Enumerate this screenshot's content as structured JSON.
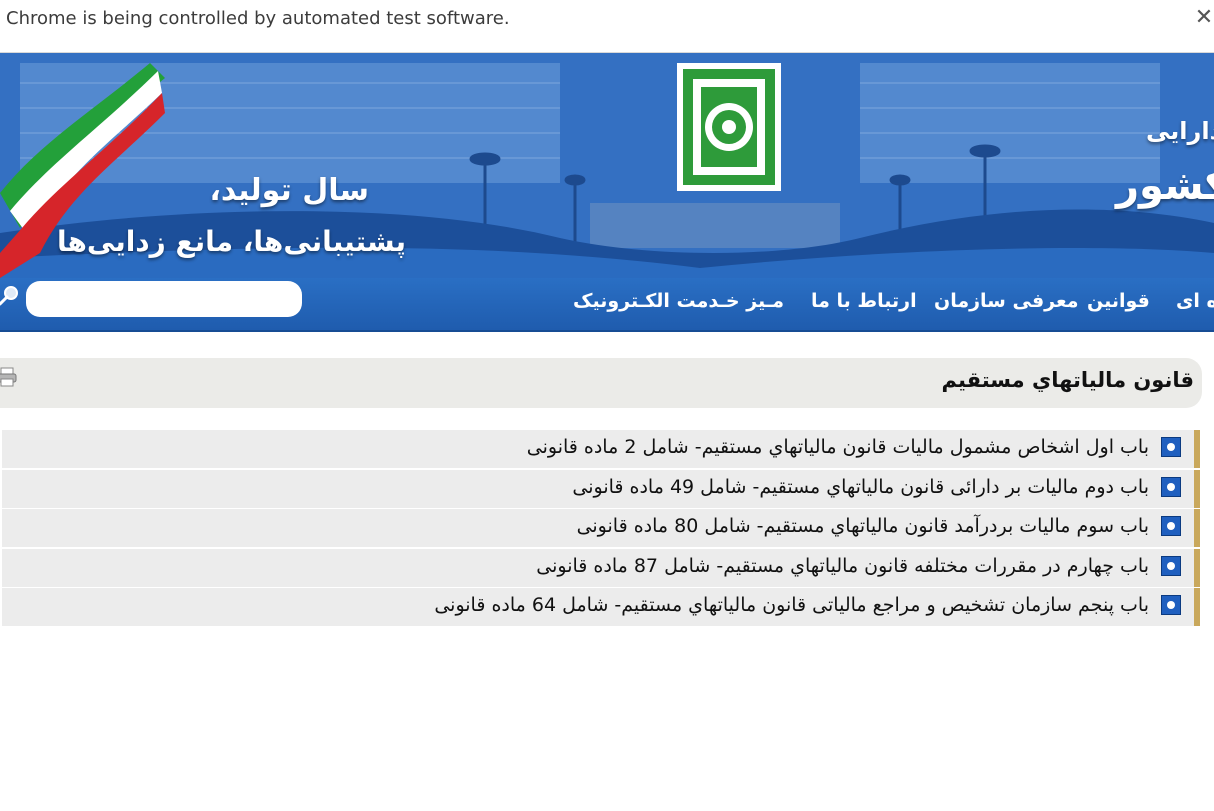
{
  "infobar": {
    "message": "Chrome is being controlled by automated test software.",
    "close_label": "✕"
  },
  "banner": {
    "slogan_line1": "سال تولید،",
    "slogan_line2": "پشتیبانی‌ها، مانع زدایی‌ها",
    "org_line1": "ی و دارایی",
    "org_line2": "یاتی کشور",
    "colors": {
      "sky": "#2f63b7",
      "emblem_green": "#2e9b3a"
    }
  },
  "nav": {
    "items": [
      {
        "label": "ه ای"
      },
      {
        "label": "قوانین"
      },
      {
        "label": "معرفی سازمان"
      },
      {
        "label": "ارتباط با ما"
      },
      {
        "label": "مـیز خـدمت الکـترونیک"
      }
    ],
    "search": {
      "value": "",
      "placeholder": ""
    }
  },
  "content": {
    "title": "قانون مالياتهاي مستقيم",
    "items": [
      {
        "label": "باب اول اشخاص مشمول ماليات قانون مالياتهاي مستقيم- شامل 2 ماده قانونی"
      },
      {
        "label": "باب دوم ماليات بر دارائی قانون مالياتهاي مستقيم- شامل 49 ماده قانونی"
      },
      {
        "label": "باب سوم ماليات بردرآمد قانون مالياتهاي مستقيم- شامل 80 ماده قانونی"
      },
      {
        "label": "باب چهارم در مقررات مختلفه قانون مالياتهاي مستقيم- شامل 87 ماده قانونی"
      },
      {
        "label": "باب پنجم سازمان تشخيص و مراجع مالیاتی قانون مالياتهاي مستقيم- شامل 64 ماده قانونی"
      }
    ],
    "accent_color": "#c9a85c"
  }
}
